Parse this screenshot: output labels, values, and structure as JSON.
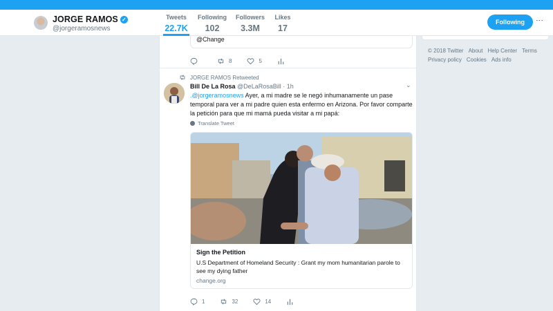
{
  "profile": {
    "name": "JORGE RAMOS",
    "verified_icon": "verified-badge-icon",
    "handle": "@jorgeramosnews"
  },
  "stats": [
    {
      "label": "Tweets",
      "value": "22.7K"
    },
    {
      "label": "Following",
      "value": "102"
    },
    {
      "label": "Followers",
      "value": "3.3M"
    },
    {
      "label": "Likes",
      "value": "17"
    }
  ],
  "follow_button": "Following",
  "previous_tweet": {
    "card_text": "@Change",
    "actions": {
      "reply": "",
      "retweet": "8",
      "like": "5"
    }
  },
  "retweet_context": "JORGE RAMOS Retweeted",
  "tweet": {
    "author_name": "Bill De La Rosa",
    "author_handle": "@DeLaRosaBill",
    "separator": " · ",
    "time": "1h",
    "mention": ".@jorgeramosnews",
    "text": " Ayer, a mi madre se le negó inhumanamente un pase temporal para ver a mi padre quien esta enfermo en Arizona. Por favor comparte la petición para que mi mamá pueda visitar a mi papá:",
    "translate": "Translate Tweet",
    "card": {
      "title": "Sign the Petition",
      "description": "U.S Department of Homeland Security : Grant my mom humanitarian parole to see my dying father",
      "domain": "change.org"
    },
    "actions": {
      "reply": "1",
      "retweet": "32",
      "like": "14"
    }
  },
  "footer_links": [
    "© 2018 Twitter",
    "About",
    "Help Center",
    "Terms",
    "Privacy policy",
    "Cookies",
    "Ads info"
  ],
  "colors": {
    "accent": "#1da1f2",
    "background": "#e6ecf0",
    "muted": "#657786"
  }
}
